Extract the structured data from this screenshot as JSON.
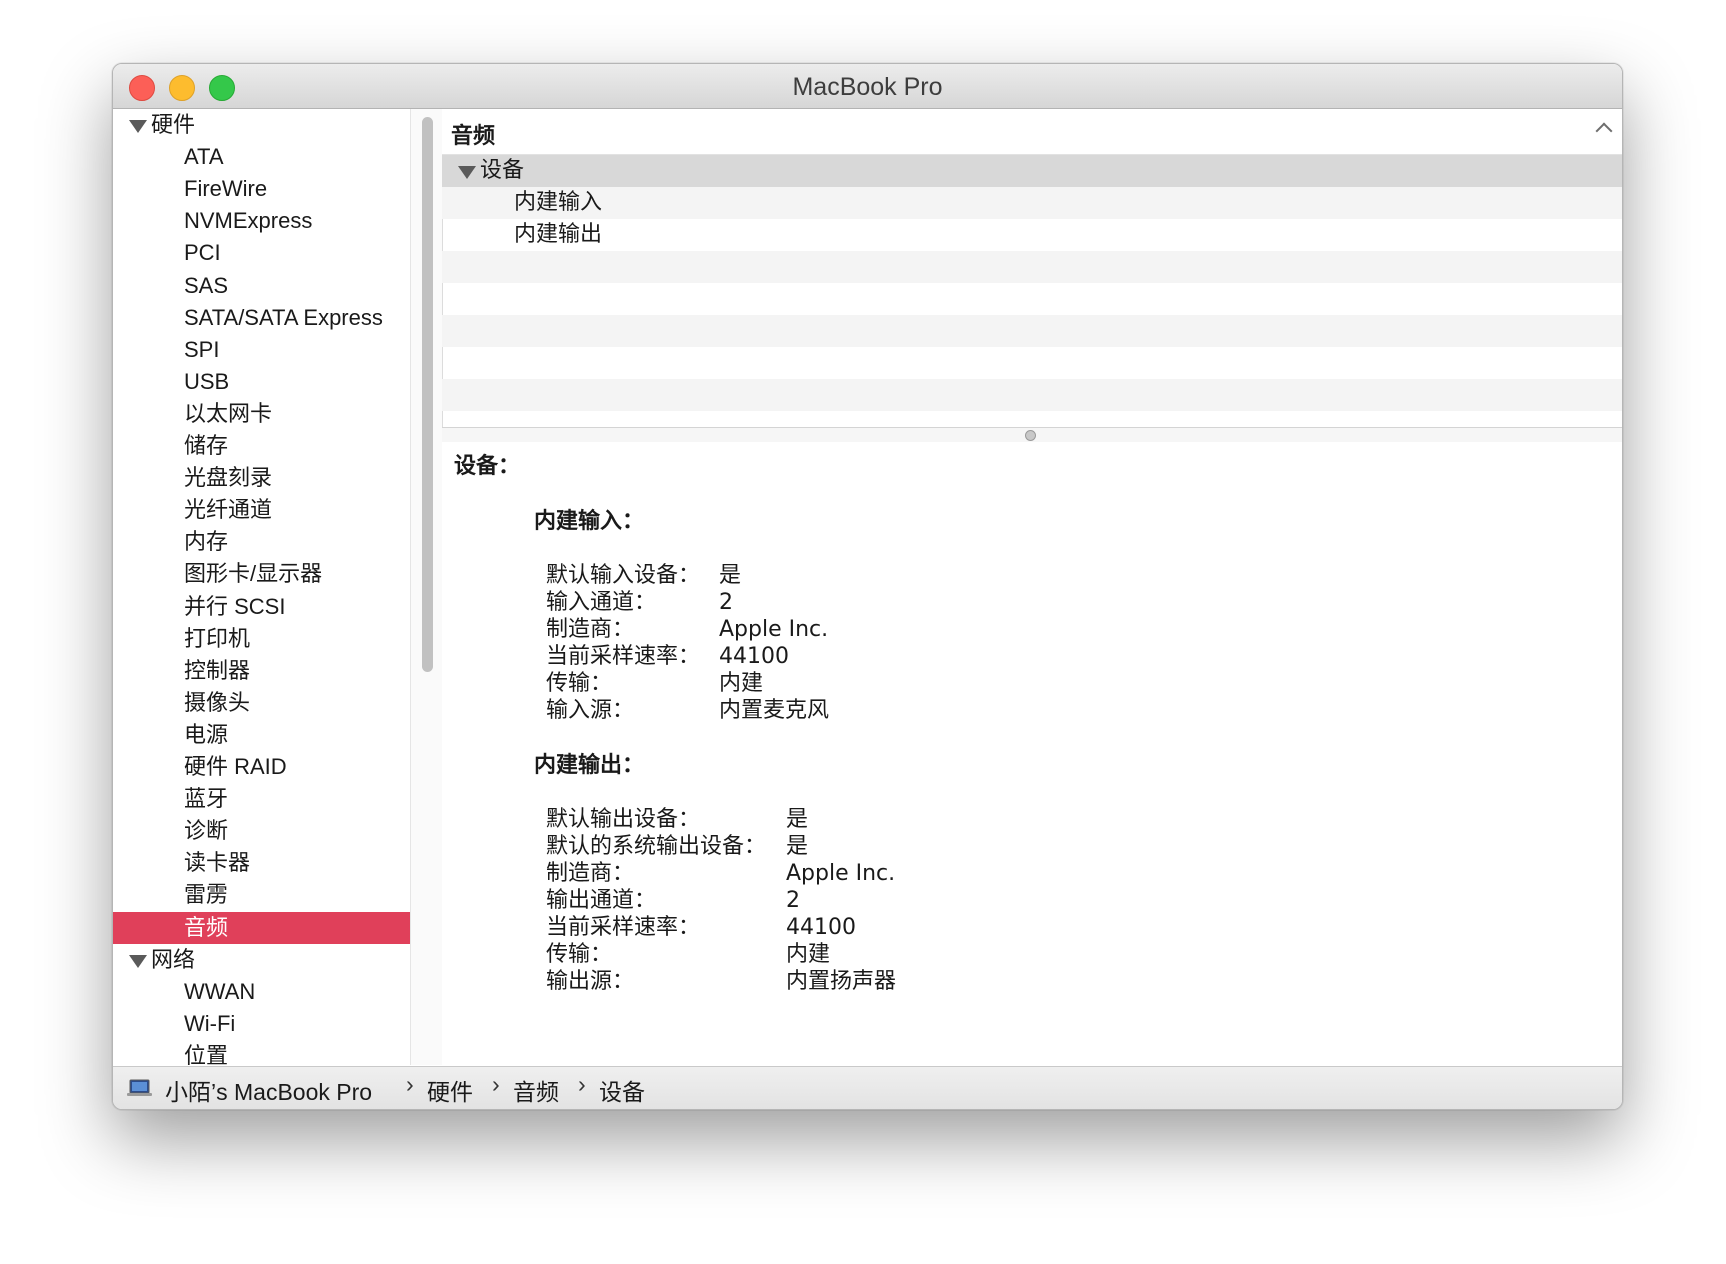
{
  "window": {
    "title": "MacBook Pro"
  },
  "sidebar": {
    "items": [
      {
        "label": "硬件",
        "type": "category"
      },
      {
        "label": "ATA",
        "type": "item"
      },
      {
        "label": "FireWire",
        "type": "item"
      },
      {
        "label": "NVMExpress",
        "type": "item"
      },
      {
        "label": "PCI",
        "type": "item"
      },
      {
        "label": "SAS",
        "type": "item"
      },
      {
        "label": "SATA/SATA Express",
        "type": "item"
      },
      {
        "label": "SPI",
        "type": "item"
      },
      {
        "label": "USB",
        "type": "item"
      },
      {
        "label": "以太网卡",
        "type": "item"
      },
      {
        "label": "储存",
        "type": "item"
      },
      {
        "label": "光盘刻录",
        "type": "item"
      },
      {
        "label": "光纤通道",
        "type": "item"
      },
      {
        "label": "内存",
        "type": "item"
      },
      {
        "label": "图形卡/显示器",
        "type": "item"
      },
      {
        "label": "并行 SCSI",
        "type": "item"
      },
      {
        "label": "打印机",
        "type": "item"
      },
      {
        "label": "控制器",
        "type": "item"
      },
      {
        "label": "摄像头",
        "type": "item"
      },
      {
        "label": "电源",
        "type": "item"
      },
      {
        "label": "硬件 RAID",
        "type": "item"
      },
      {
        "label": "蓝牙",
        "type": "item"
      },
      {
        "label": "诊断",
        "type": "item"
      },
      {
        "label": "读卡器",
        "type": "item"
      },
      {
        "label": "雷雳",
        "type": "item"
      },
      {
        "label": "音频",
        "type": "item",
        "selected": true
      },
      {
        "label": "网络",
        "type": "category"
      },
      {
        "label": "WWAN",
        "type": "item"
      },
      {
        "label": "Wi-Fi",
        "type": "item"
      },
      {
        "label": "位置",
        "type": "item"
      }
    ]
  },
  "list": {
    "header": "音频",
    "group": "设备",
    "rows": [
      "内建输入",
      "内建输出"
    ]
  },
  "detail": {
    "title": "设备：",
    "sections": [
      {
        "title": "内建输入：",
        "rows": [
          {
            "key": "默认输入设备：",
            "value": "是"
          },
          {
            "key": "输入通道：",
            "value": "2"
          },
          {
            "key": "制造商：",
            "value": "Apple Inc."
          },
          {
            "key": "当前采样速率：",
            "value": "44100"
          },
          {
            "key": "传输：",
            "value": "内建"
          },
          {
            "key": "输入源：",
            "value": "内置麦克风"
          }
        ]
      },
      {
        "title": "内建输出：",
        "rows": [
          {
            "key": "默认输出设备：",
            "value": "是"
          },
          {
            "key": "默认的系统输出设备：",
            "value": "是"
          },
          {
            "key": "制造商：",
            "value": "Apple Inc."
          },
          {
            "key": "输出通道：",
            "value": "2"
          },
          {
            "key": "当前采样速率：",
            "value": "44100"
          },
          {
            "key": "传输：",
            "value": "内建"
          },
          {
            "key": "输出源：",
            "value": "内置扬声器"
          }
        ]
      }
    ]
  },
  "pathbar": {
    "icon": "laptop-icon",
    "items": [
      "小陌’s MacBook Pro",
      "硬件",
      "音频",
      "设备"
    ],
    "separator": "›"
  }
}
